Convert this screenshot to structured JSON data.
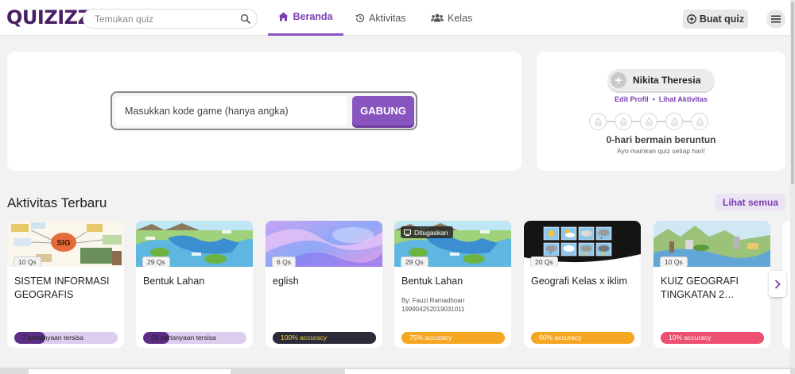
{
  "header": {
    "logo": "QUIZIZZ",
    "search_placeholder": "Temukan quiz",
    "tabs": [
      {
        "label": "Beranda",
        "active": true
      },
      {
        "label": "Aktivitas",
        "active": false
      },
      {
        "label": "Kelas",
        "active": false
      }
    ],
    "create_label": "Buat quiz"
  },
  "join": {
    "placeholder": "Masukkan kode game (hanya angka)",
    "button_label": "GABUNG"
  },
  "profile": {
    "name": "Nikita Theresia",
    "edit_label": "Edit Profil",
    "separator": "•",
    "activity_label": "Lihat Aktivitas",
    "streak_title": "0-hari bermain beruntun",
    "streak_sub": "Ayo mainkan quiz setiap hari!"
  },
  "section": {
    "title": "Aktivitas Terbaru",
    "see_all": "Lihat semua"
  },
  "cards": [
    {
      "qs": "10 Qs",
      "title": "SISTEM INFORMASI GEOGRAFIS",
      "progress_label": "7 pertanyaan tersisa",
      "progress": 0.3,
      "bar_color": "#5b2d84",
      "track_color": "#ddcdee",
      "thumb": "sig"
    },
    {
      "qs": "29 Qs",
      "title": "Bentuk Lahan",
      "progress_label": "29 pertanyaan tersisa",
      "progress": 0.25,
      "bar_color": "#5b2d84",
      "track_color": "#ddcdee",
      "thumb": "land"
    },
    {
      "qs": "6 Qs",
      "title": "eglish",
      "progress_label": "100% accuracy",
      "progress": 1.0,
      "bar_color": "#2b2b3a",
      "track_color": "#2b2b3a",
      "thumb": "fluid"
    },
    {
      "qs": "29 Qs",
      "title": "Bentuk Lahan",
      "assigned": "Ditugaskan",
      "by_line": "By: Fauzi Ramadhoan",
      "by_id": "199904252019031011",
      "progress_label": "75% accuracy",
      "progress": 1.0,
      "bar_color": "#f5a623",
      "track_color": "#f5a623",
      "thumb": "land"
    },
    {
      "qs": "20 Qs",
      "title": "Geografi Kelas x iklim",
      "progress_label": "60% accuracy",
      "progress": 1.0,
      "bar_color": "#f5a623",
      "track_color": "#f5a623",
      "thumb": "weather"
    },
    {
      "qs": "10 Qs",
      "title": "KUIZ GEOGRAFI TINGKATAN 2…",
      "progress_label": "10% accuracy",
      "progress": 1.0,
      "bar_color": "#ec4f6f",
      "track_color": "#ec4f6f",
      "thumb": "geo"
    }
  ],
  "colors": {
    "brand": "#8854c0",
    "logo": "#4a1f64"
  }
}
